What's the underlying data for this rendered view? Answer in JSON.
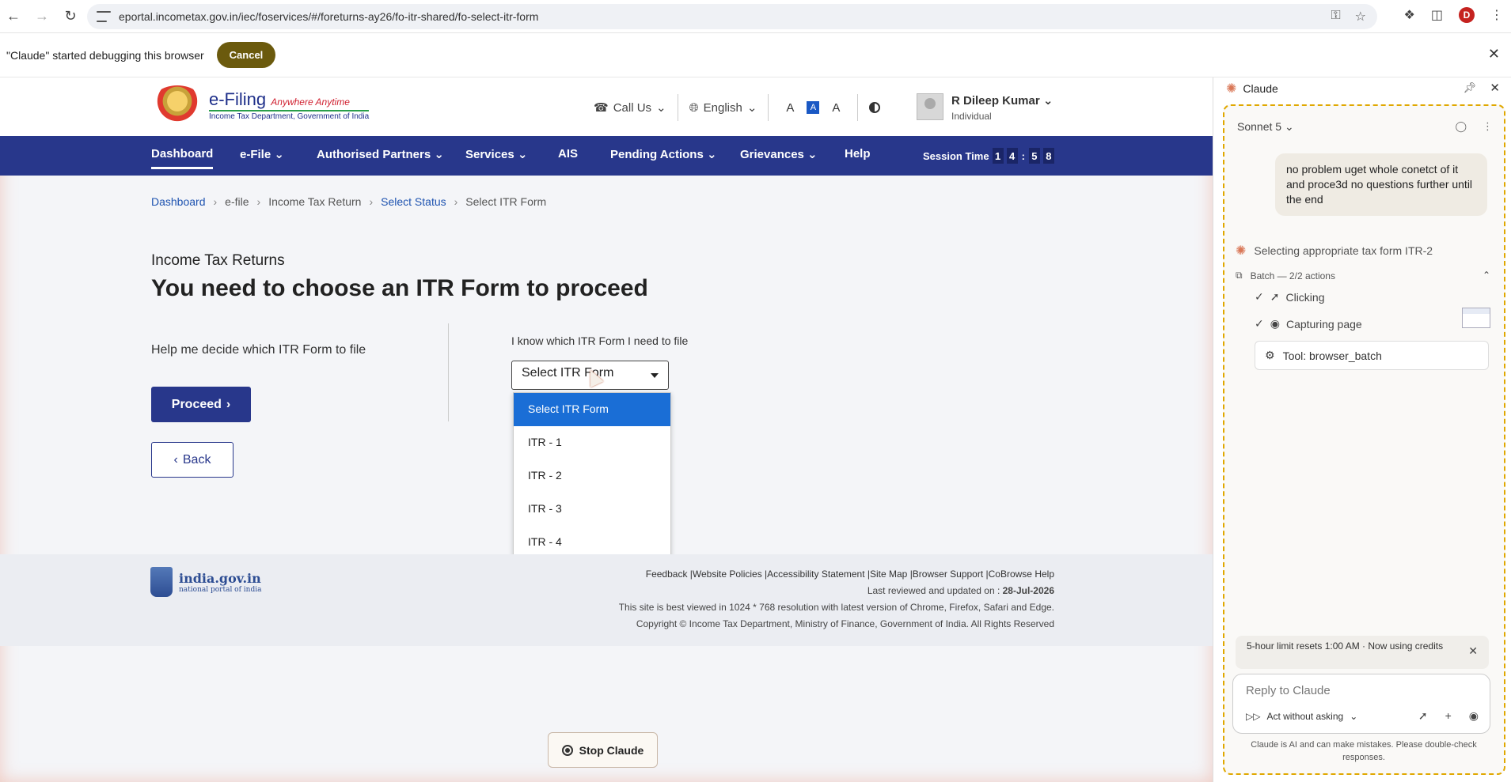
{
  "browser": {
    "url": "eportal.incometax.gov.in/iec/foservices/#/foreturns-ay26/fo-itr-shared/fo-select-itr-form",
    "profile_initial": "D"
  },
  "debug_bar": {
    "message": "\"Claude\" started debugging this browser",
    "cancel_label": "Cancel"
  },
  "header": {
    "logo_title": "e-Filing",
    "logo_tagline": "Anywhere Anytime",
    "logo_sub": "Income Tax Department, Government of India",
    "call_us": "Call Us",
    "language": "English",
    "font_decrease": "A",
    "font_default": "A",
    "font_increase": "A",
    "user_name": "R Dileep Kumar",
    "user_role": "Individual"
  },
  "nav": {
    "items": [
      "Dashboard",
      "e-File",
      "Authorised Partners",
      "Services",
      "AIS",
      "Pending Actions",
      "Grievances",
      "Help"
    ],
    "session_label": "Session Time",
    "session_digits": [
      "1",
      "4",
      "5",
      "8"
    ]
  },
  "breadcrumb": [
    "Dashboard",
    "e-file",
    "Income Tax Return",
    "Select Status",
    "Select ITR Form"
  ],
  "page": {
    "pre_title": "Income Tax Returns",
    "title": "You need to choose an ITR Form to proceed",
    "help_text": "Help me decide which ITR Form to file",
    "proceed_label": "Proceed",
    "back_label": "Back",
    "know_label": "I know which ITR Form I need to file",
    "select_value": "Select ITR Form",
    "options": [
      "Select ITR Form",
      "ITR - 1",
      "ITR - 2",
      "ITR - 3",
      "ITR - 4"
    ]
  },
  "footer": {
    "gov_title": "india.gov.in",
    "gov_sub": "national portal of india",
    "links": "Feedback |Website Policies |Accessibility Statement |Site Map |Browser Support |CoBrowse Help",
    "reviewed_label": "Last reviewed and updated on : ",
    "reviewed_date": "28-Jul-2026",
    "resolution_note": "This site is best viewed in 1024 * 768 resolution with latest version of Chrome, Firefox, Safari and Edge.",
    "copyright": "Copyright © Income Tax Department, Ministry of Finance, Government of India. All Rights Reserved"
  },
  "stop_claude_label": "Stop Claude",
  "claude_panel": {
    "title": "Claude",
    "model": "Sonnet 5",
    "user_message": "no problem uget whole conetct of it and proce3d no questions further until the end",
    "status": "Selecting appropriate tax form ITR-2",
    "batch_title": "Batch — 2/2 actions",
    "steps": [
      "Clicking",
      "Capturing page"
    ],
    "tool_label": "Tool: browser_batch",
    "limit_banner": "5-hour limit resets 1:00 AM · Now using credits",
    "reply_placeholder": "Reply to Claude",
    "act_mode": "Act without asking",
    "disclaimer": "Claude is AI and can make mistakes. Please double-check responses."
  },
  "colors": {
    "nav_bg": "#28378b",
    "accent_blue": "#1a6ed6",
    "cancel_bg": "#6b5a0d",
    "claude_accent": "#d97757"
  }
}
